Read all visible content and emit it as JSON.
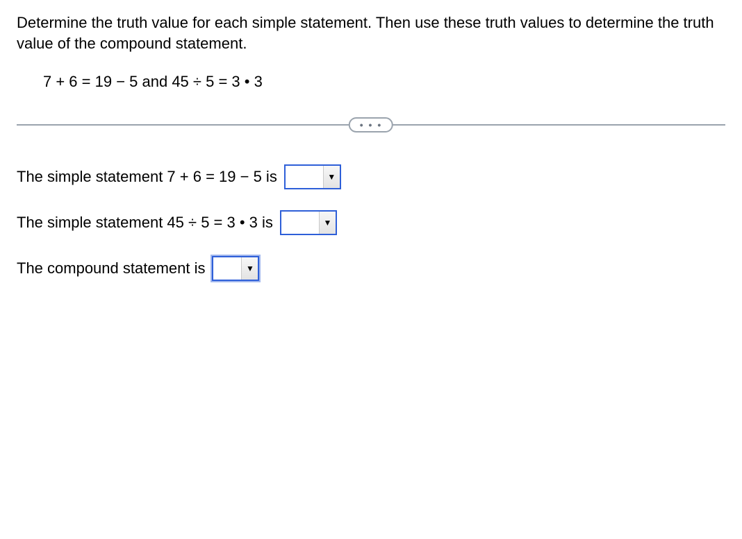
{
  "instructions": "Determine the truth value for each simple statement. Then use these truth values to determine the truth value of the compound statement.",
  "formula": "7 + 6 = 19 − 5 and 45 ÷ 5 = 3 • 3",
  "divider_dots": "• • •",
  "rows": {
    "r1": "The simple statement 7 + 6 = 19 − 5 is",
    "r2": "The simple statement 45 ÷ 5 = 3 • 3 is",
    "r3": "The compound statement is"
  },
  "arrow_glyph": "▼"
}
